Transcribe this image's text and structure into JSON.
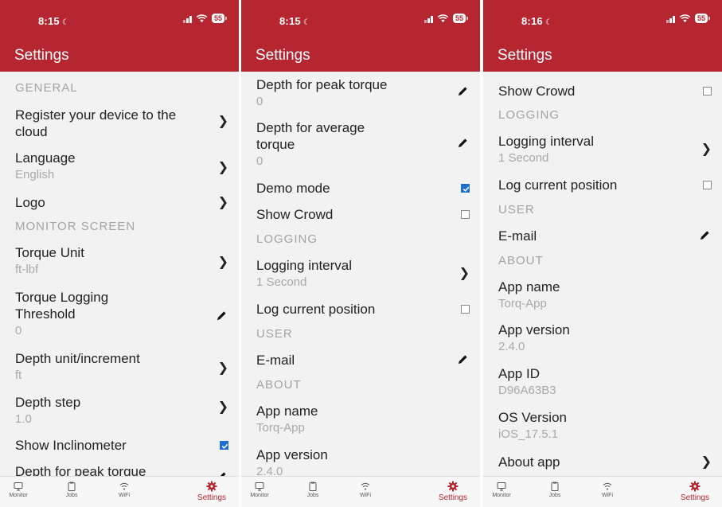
{
  "colors": {
    "accent": "#b52630",
    "checkbox_checked": "#1f6fce",
    "background": "#f2f2f2",
    "section_text": "#a3a3a3",
    "subtitle_text": "#a8a8a8"
  },
  "screens": [
    {
      "status_time": "8:15",
      "battery": "55",
      "title": "Settings",
      "sections": {
        "general": "GENERAL",
        "monitor_screen": "MONITOR SCREEN"
      },
      "rows": {
        "register": {
          "title": "Register your device to the cloud",
          "control": "chevron-right-icon"
        },
        "language": {
          "title": "Language",
          "value": "English",
          "control": "chevron-right-icon"
        },
        "logo": {
          "title": "Logo",
          "control": "chevron-right-icon"
        },
        "torque_unit": {
          "title": "Torque Unit",
          "value": "ft-lbf",
          "control": "chevron-right-icon"
        },
        "torque_logging_threshold": {
          "title": "Torque Logging Threshold",
          "value": "0",
          "control": "pencil-icon"
        },
        "depth_unit": {
          "title": "Depth unit/increment",
          "value": "ft",
          "control": "chevron-right-icon"
        },
        "depth_step": {
          "title": "Depth step",
          "value": "1.0",
          "control": "chevron-right-icon"
        },
        "show_inclinometer": {
          "title": "Show Inclinometer",
          "checked": true
        },
        "depth_peak_torque": {
          "title": "Depth for peak torque",
          "control": "pencil-icon"
        }
      }
    },
    {
      "status_time": "8:15",
      "battery": "55",
      "title": "Settings",
      "sections": {
        "logging": "LOGGING",
        "user": "USER",
        "about": "ABOUT"
      },
      "rows": {
        "depth_peak_torque": {
          "title": "Depth for peak torque",
          "value": "0",
          "control": "pencil-icon"
        },
        "depth_avg_torque": {
          "title": "Depth for average torque",
          "value": "0",
          "control": "pencil-icon"
        },
        "demo_mode": {
          "title": "Demo mode",
          "checked": true
        },
        "show_crowd": {
          "title": "Show Crowd",
          "checked": false
        },
        "logging_interval": {
          "title": "Logging interval",
          "value": "1 Second",
          "control": "chevron-right-icon"
        },
        "log_current_position": {
          "title": "Log current position",
          "checked": false
        },
        "email": {
          "title": "E-mail",
          "control": "pencil-icon"
        },
        "app_name": {
          "title": "App name",
          "value": "Torq-App"
        },
        "app_version": {
          "title": "App version",
          "value": "2.4.0"
        }
      }
    },
    {
      "status_time": "8:16",
      "battery": "55",
      "title": "Settings",
      "sections": {
        "logging": "LOGGING",
        "user": "USER",
        "about": "ABOUT"
      },
      "rows": {
        "show_crowd": {
          "title": "Show Crowd",
          "checked": false
        },
        "logging_interval": {
          "title": "Logging interval",
          "value": "1 Second",
          "control": "chevron-right-icon"
        },
        "log_current_position": {
          "title": "Log current position",
          "checked": false
        },
        "email": {
          "title": "E-mail",
          "control": "pencil-icon"
        },
        "app_name": {
          "title": "App name",
          "value": "Torq-App"
        },
        "app_version": {
          "title": "App version",
          "value": "2.4.0"
        },
        "app_id": {
          "title": "App ID",
          "value": "D96A63B3"
        },
        "os_version": {
          "title": "OS Version",
          "value": "iOS_17.5.1"
        },
        "about_app": {
          "title": "About app",
          "control": "chevron-right-icon"
        }
      }
    }
  ],
  "tabs": [
    {
      "label": "Monitor",
      "icon": "monitor-icon",
      "active": false
    },
    {
      "label": "Jobs",
      "icon": "clipboard-icon",
      "active": false
    },
    {
      "label": "WiFi",
      "icon": "wifi-icon",
      "active": false
    },
    {
      "label": "Settings",
      "icon": "gear-icon",
      "active": true
    }
  ]
}
